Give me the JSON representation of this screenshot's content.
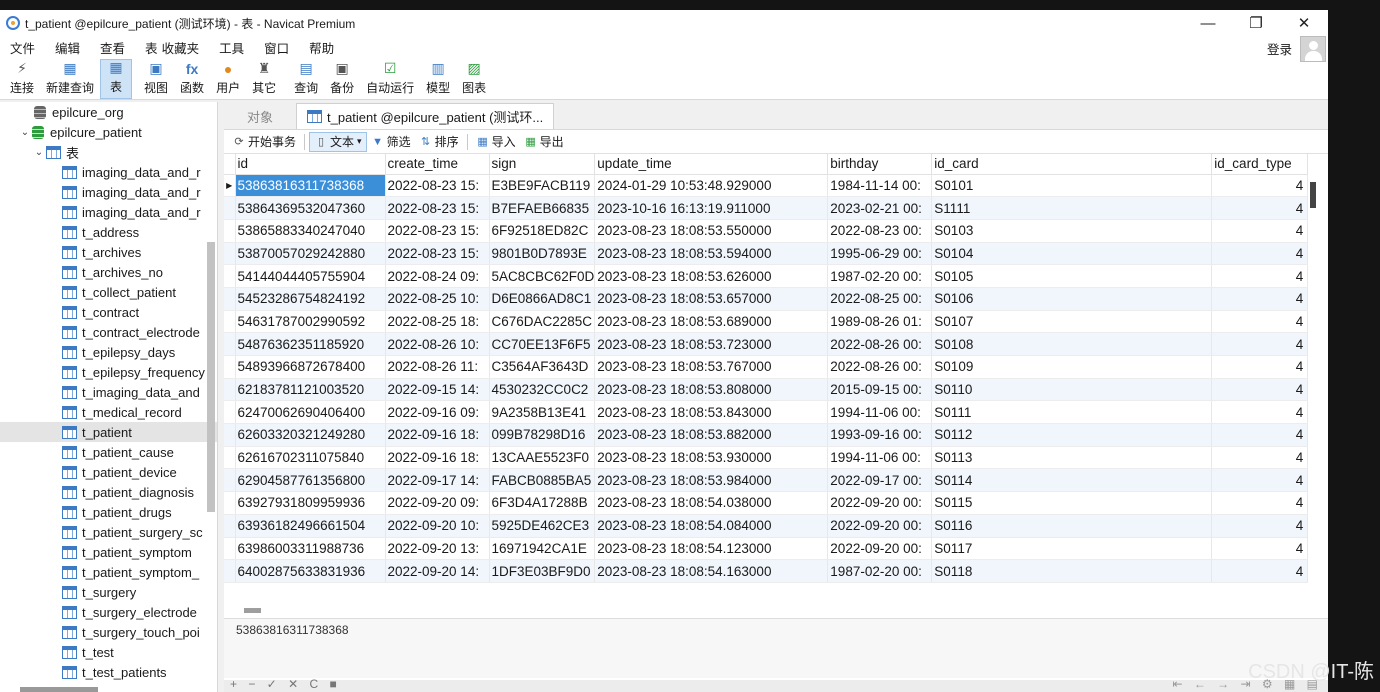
{
  "window": {
    "title": "t_patient @epilcure_patient (测试环境) - 表 - Navicat Premium",
    "minimize": "—",
    "maximize": "❐",
    "close": "✕"
  },
  "menu": {
    "items": [
      "文件",
      "编辑",
      "查看",
      "表",
      "收藏夹",
      "工具",
      "窗口",
      "帮助"
    ],
    "login": "登录"
  },
  "toolbar": {
    "items": [
      {
        "label": "连接",
        "icon": "connect-icon",
        "glyph": "⚡",
        "color": "#555"
      },
      {
        "label": "新建查询",
        "icon": "new-query-icon",
        "glyph": "▦",
        "color": "#3c7bc4"
      },
      {
        "label": "表",
        "icon": "table-icon",
        "glyph": "▦",
        "color": "#3c7bc4"
      },
      {
        "label": "视图",
        "icon": "view-icon",
        "glyph": "▣",
        "color": "#3c7bc4"
      },
      {
        "label": "函数",
        "icon": "function-icon",
        "glyph": "fx",
        "color": "#3c7bc4"
      },
      {
        "label": "用户",
        "icon": "user-icon",
        "glyph": "●",
        "color": "#e08a1e"
      },
      {
        "label": "其它",
        "icon": "other-icon",
        "glyph": "♜",
        "color": "#555"
      },
      {
        "label": "查询",
        "icon": "query-icon",
        "glyph": "▤",
        "color": "#3c7bc4"
      },
      {
        "label": "备份",
        "icon": "backup-icon",
        "glyph": "▣",
        "color": "#555"
      },
      {
        "label": "自动运行",
        "icon": "automation-icon",
        "glyph": "☑",
        "color": "#2e9b3e"
      },
      {
        "label": "模型",
        "icon": "model-icon",
        "glyph": "▥",
        "color": "#3c7bc4"
      },
      {
        "label": "图表",
        "icon": "chart-icon",
        "glyph": "▨",
        "color": "#2e9b3e"
      }
    ]
  },
  "sidebar": {
    "db_other": "epilcure_org",
    "db_active": "epilcure_patient",
    "folder": "表",
    "tables": [
      "imaging_data_and_r",
      "imaging_data_and_r",
      "imaging_data_and_r",
      "t_address",
      "t_archives",
      "t_archives_no",
      "t_collect_patient",
      "t_contract",
      "t_contract_electrode",
      "t_epilepsy_days",
      "t_epilepsy_frequency",
      "t_imaging_data_and",
      "t_medical_record",
      "t_patient",
      "t_patient_cause",
      "t_patient_device",
      "t_patient_diagnosis",
      "t_patient_drugs",
      "t_patient_surgery_sc",
      "t_patient_symptom",
      "t_patient_symptom_",
      "t_surgery",
      "t_surgery_electrode",
      "t_surgery_touch_poi",
      "t_test",
      "t_test_patients"
    ],
    "selected": "t_patient"
  },
  "tabs": {
    "objects": "对象",
    "active": "t_patient @epilcure_patient (测试环..."
  },
  "subtoolbar": {
    "begin": "开始事务",
    "text": "文本",
    "filter": "筛选",
    "sort": "排序",
    "import": "导入",
    "export": "导出"
  },
  "grid": {
    "columns": [
      "id",
      "create_time",
      "sign",
      "update_time",
      "birthday",
      "id_card",
      "id_card_type"
    ],
    "rows": [
      [
        "53863816311738368",
        "2022-08-23 15:",
        "E3BE9FACB119",
        "2024-01-29 10:53:48.929000",
        "1984-11-14 00:",
        "S0101",
        "4"
      ],
      [
        "53864369532047360",
        "2022-08-23 15:",
        "B7EFAEB66835",
        "2023-10-16 16:13:19.911000",
        "2023-02-21 00:",
        "S1111",
        "4"
      ],
      [
        "53865883340247040",
        "2022-08-23 15:",
        "6F92518ED82C",
        "2023-08-23 18:08:53.550000",
        "2022-08-23 00:",
        "S0103",
        "4"
      ],
      [
        "53870057029242880",
        "2022-08-23 15:",
        "9801B0D7893E",
        "2023-08-23 18:08:53.594000",
        "1995-06-29 00:",
        "S0104",
        "4"
      ],
      [
        "54144044405755904",
        "2022-08-24 09:",
        "5AC8CBC62F0D",
        "2023-08-23 18:08:53.626000",
        "1987-02-20 00:",
        "S0105",
        "4"
      ],
      [
        "54523286754824192",
        "2022-08-25 10:",
        "D6E0866AD8C1",
        "2023-08-23 18:08:53.657000",
        "2022-08-25 00:",
        "S0106",
        "4"
      ],
      [
        "54631787002990592",
        "2022-08-25 18:",
        "C676DAC2285C",
        "2023-08-23 18:08:53.689000",
        "1989-08-26 01:",
        "S0107",
        "4"
      ],
      [
        "54876362351185920",
        "2022-08-26 10:",
        "CC70EE13F6F5",
        "2023-08-23 18:08:53.723000",
        "2022-08-26 00:",
        "S0108",
        "4"
      ],
      [
        "54893966872678400",
        "2022-08-26 11:",
        "C3564AF3643D",
        "2023-08-23 18:08:53.767000",
        "2022-08-26 00:",
        "S0109",
        "4"
      ],
      [
        "62183781121003520",
        "2022-09-15 14:",
        "4530232CC0C2",
        "2023-08-23 18:08:53.808000",
        "2015-09-15 00:",
        "S0110",
        "4"
      ],
      [
        "62470062690406400",
        "2022-09-16 09:",
        "9A2358B13E41",
        "2023-08-23 18:08:53.843000",
        "1994-11-06 00:",
        "S0111",
        "4"
      ],
      [
        "62603320321249280",
        "2022-09-16 18:",
        "099B78298D16",
        "2023-08-23 18:08:53.882000",
        "1993-09-16 00:",
        "S0112",
        "4"
      ],
      [
        "62616702311075840",
        "2022-09-16 18:",
        "13CAAE5523F0",
        "2023-08-23 18:08:53.930000",
        "1994-11-06 00:",
        "S0113",
        "4"
      ],
      [
        "62904587761356800",
        "2022-09-17 14:",
        "FABCB0885BA5",
        "2023-08-23 18:08:53.984000",
        "2022-09-17 00:",
        "S0114",
        "4"
      ],
      [
        "63927931809959936",
        "2022-09-20 09:",
        "6F3D4A17288B",
        "2023-08-23 18:08:54.038000",
        "2022-09-20 00:",
        "S0115",
        "4"
      ],
      [
        "63936182496661504",
        "2022-09-20 10:",
        "5925DE462CE3",
        "2023-08-23 18:08:54.084000",
        "2022-09-20 00:",
        "S0116",
        "4"
      ],
      [
        "63986003311988736",
        "2022-09-20 13:",
        "16971942CA1E",
        "2023-08-23 18:08:54.123000",
        "2022-09-20 00:",
        "S0117",
        "4"
      ],
      [
        "64002875633831936",
        "2022-09-20 14:",
        "1DF3E03BF9D0",
        "2023-08-23 18:08:54.163000",
        "1987-02-20 00:",
        "S0118",
        "4"
      ]
    ],
    "selected_row_marker": "▶"
  },
  "detail_value": "53863816311738368",
  "statusbar": {
    "left_controls": "+ − ✓ ✕ C ■",
    "right_controls": "⇤ ← → ⇥ ⚙ ▦ ▤"
  },
  "watermark": "CSDN @IT-陈"
}
